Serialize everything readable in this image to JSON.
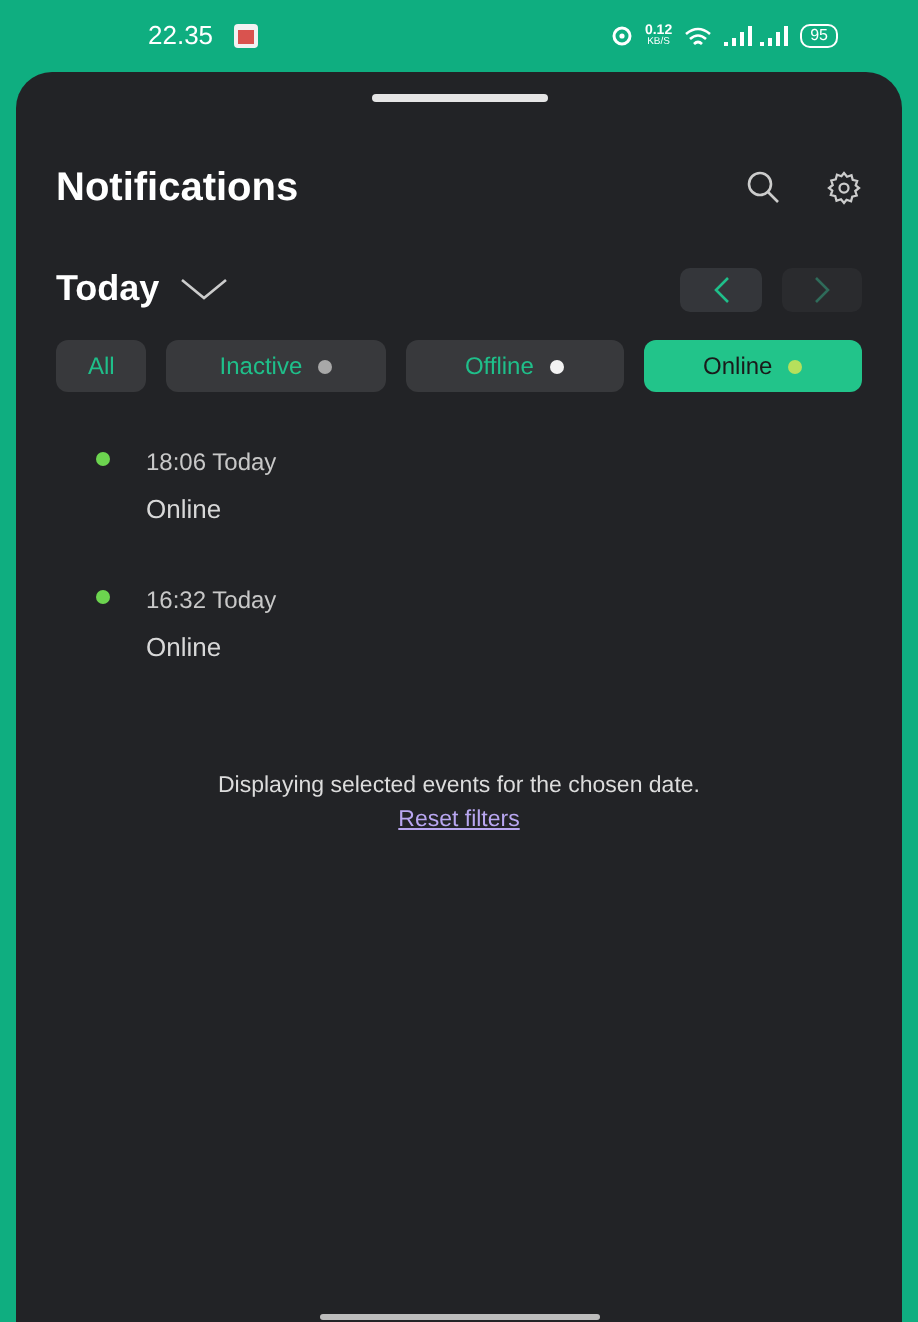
{
  "status_bar": {
    "time": "22.35",
    "speed_value": "0.12",
    "speed_unit": "KB/S",
    "battery": "95"
  },
  "header": {
    "title": "Notifications"
  },
  "date_picker": {
    "label": "Today",
    "prev_disabled": false,
    "next_disabled": true
  },
  "filters": [
    {
      "label": "All",
      "selected": false
    },
    {
      "label": "Inactive",
      "selected": false,
      "color": "#a8a8a8"
    },
    {
      "label": "Offline",
      "selected": false,
      "color": "#f2f2f2"
    },
    {
      "label": "Online",
      "selected": true,
      "color": "#b6e05c"
    }
  ],
  "events": [
    {
      "time": "18:06 Today",
      "status": "Online",
      "color": "#6cd44f"
    },
    {
      "time": "16:32 Today",
      "status": "Online",
      "color": "#6cd44f"
    }
  ],
  "footer": {
    "message": "Displaying selected events for the chosen date.",
    "link": "Reset filters"
  }
}
